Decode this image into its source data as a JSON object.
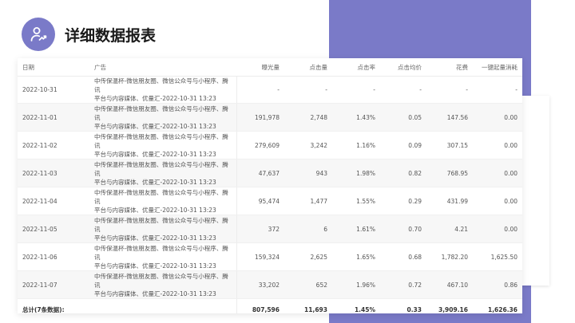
{
  "page": {
    "title": "详细数据报表"
  },
  "icons": {
    "logo": "user-trend-icon"
  },
  "colors": {
    "accent": "#7a7ac8"
  },
  "table": {
    "columns": [
      "日期",
      "广告",
      "曝光量",
      "点击量",
      "点击率",
      "点击均价",
      "花费",
      "一键起量消耗"
    ],
    "rows": [
      {
        "date": "2022-10-31",
        "ad_line1": "中传保温杯-微信朋友圈、微信公众号与小程序、腾讯",
        "ad_line2": "平台与内容媒体、优量汇-2022-10-31 13:23",
        "impressions": "-",
        "clicks": "-",
        "ctr": "-",
        "cpc": "-",
        "cost": "-",
        "quick": "-"
      },
      {
        "date": "2022-11-01",
        "ad_line1": "中传保温杯-微信朋友圈、微信公众号与小程序、腾讯",
        "ad_line2": "平台与内容媒体、优量汇-2022-10-31 13:23",
        "impressions": "191,978",
        "clicks": "2,748",
        "ctr": "1.43%",
        "cpc": "0.05",
        "cost": "147.56",
        "quick": "0.00"
      },
      {
        "date": "2022-11-02",
        "ad_line1": "中传保温杯-微信朋友圈、微信公众号与小程序、腾讯",
        "ad_line2": "平台与内容媒体、优量汇-2022-10-31 13:23",
        "impressions": "279,609",
        "clicks": "3,242",
        "ctr": "1.16%",
        "cpc": "0.09",
        "cost": "307.15",
        "quick": "0.00"
      },
      {
        "date": "2022-11-03",
        "ad_line1": "中传保温杯-微信朋友圈、微信公众号与小程序、腾讯",
        "ad_line2": "平台与内容媒体、优量汇-2022-10-31 13:23",
        "impressions": "47,637",
        "clicks": "943",
        "ctr": "1.98%",
        "cpc": "0.82",
        "cost": "768.95",
        "quick": "0.00"
      },
      {
        "date": "2022-11-04",
        "ad_line1": "中传保温杯-微信朋友圈、微信公众号与小程序、腾讯",
        "ad_line2": "平台与内容媒体、优量汇-2022-10-31 13:23",
        "impressions": "95,474",
        "clicks": "1,477",
        "ctr": "1.55%",
        "cpc": "0.29",
        "cost": "431.99",
        "quick": "0.00"
      },
      {
        "date": "2022-11-05",
        "ad_line1": "中传保温杯-微信朋友圈、微信公众号与小程序、腾讯",
        "ad_line2": "平台与内容媒体、优量汇-2022-10-31 13:23",
        "impressions": "372",
        "clicks": "6",
        "ctr": "1.61%",
        "cpc": "0.70",
        "cost": "4.21",
        "quick": "0.00"
      },
      {
        "date": "2022-11-06",
        "ad_line1": "中传保温杯-微信朋友圈、微信公众号与小程序、腾讯",
        "ad_line2": "平台与内容媒体、优量汇-2022-10-31 13:23",
        "impressions": "159,324",
        "clicks": "2,625",
        "ctr": "1.65%",
        "cpc": "0.68",
        "cost": "1,782.20",
        "quick": "1,625.50"
      },
      {
        "date": "2022-11-07",
        "ad_line1": "中传保温杯-微信朋友圈、微信公众号与小程序、腾讯",
        "ad_line2": "平台与内容媒体、优量汇-2022-10-31 13:23",
        "impressions": "33,202",
        "clicks": "652",
        "ctr": "1.96%",
        "cpc": "0.72",
        "cost": "467.10",
        "quick": "0.86"
      }
    ],
    "total": {
      "label": "总计(7条数据):",
      "impressions": "807,596",
      "clicks": "11,693",
      "ctr": "1.45%",
      "cpc": "0.33",
      "cost": "3,909.16",
      "quick": "1,626.36"
    }
  }
}
